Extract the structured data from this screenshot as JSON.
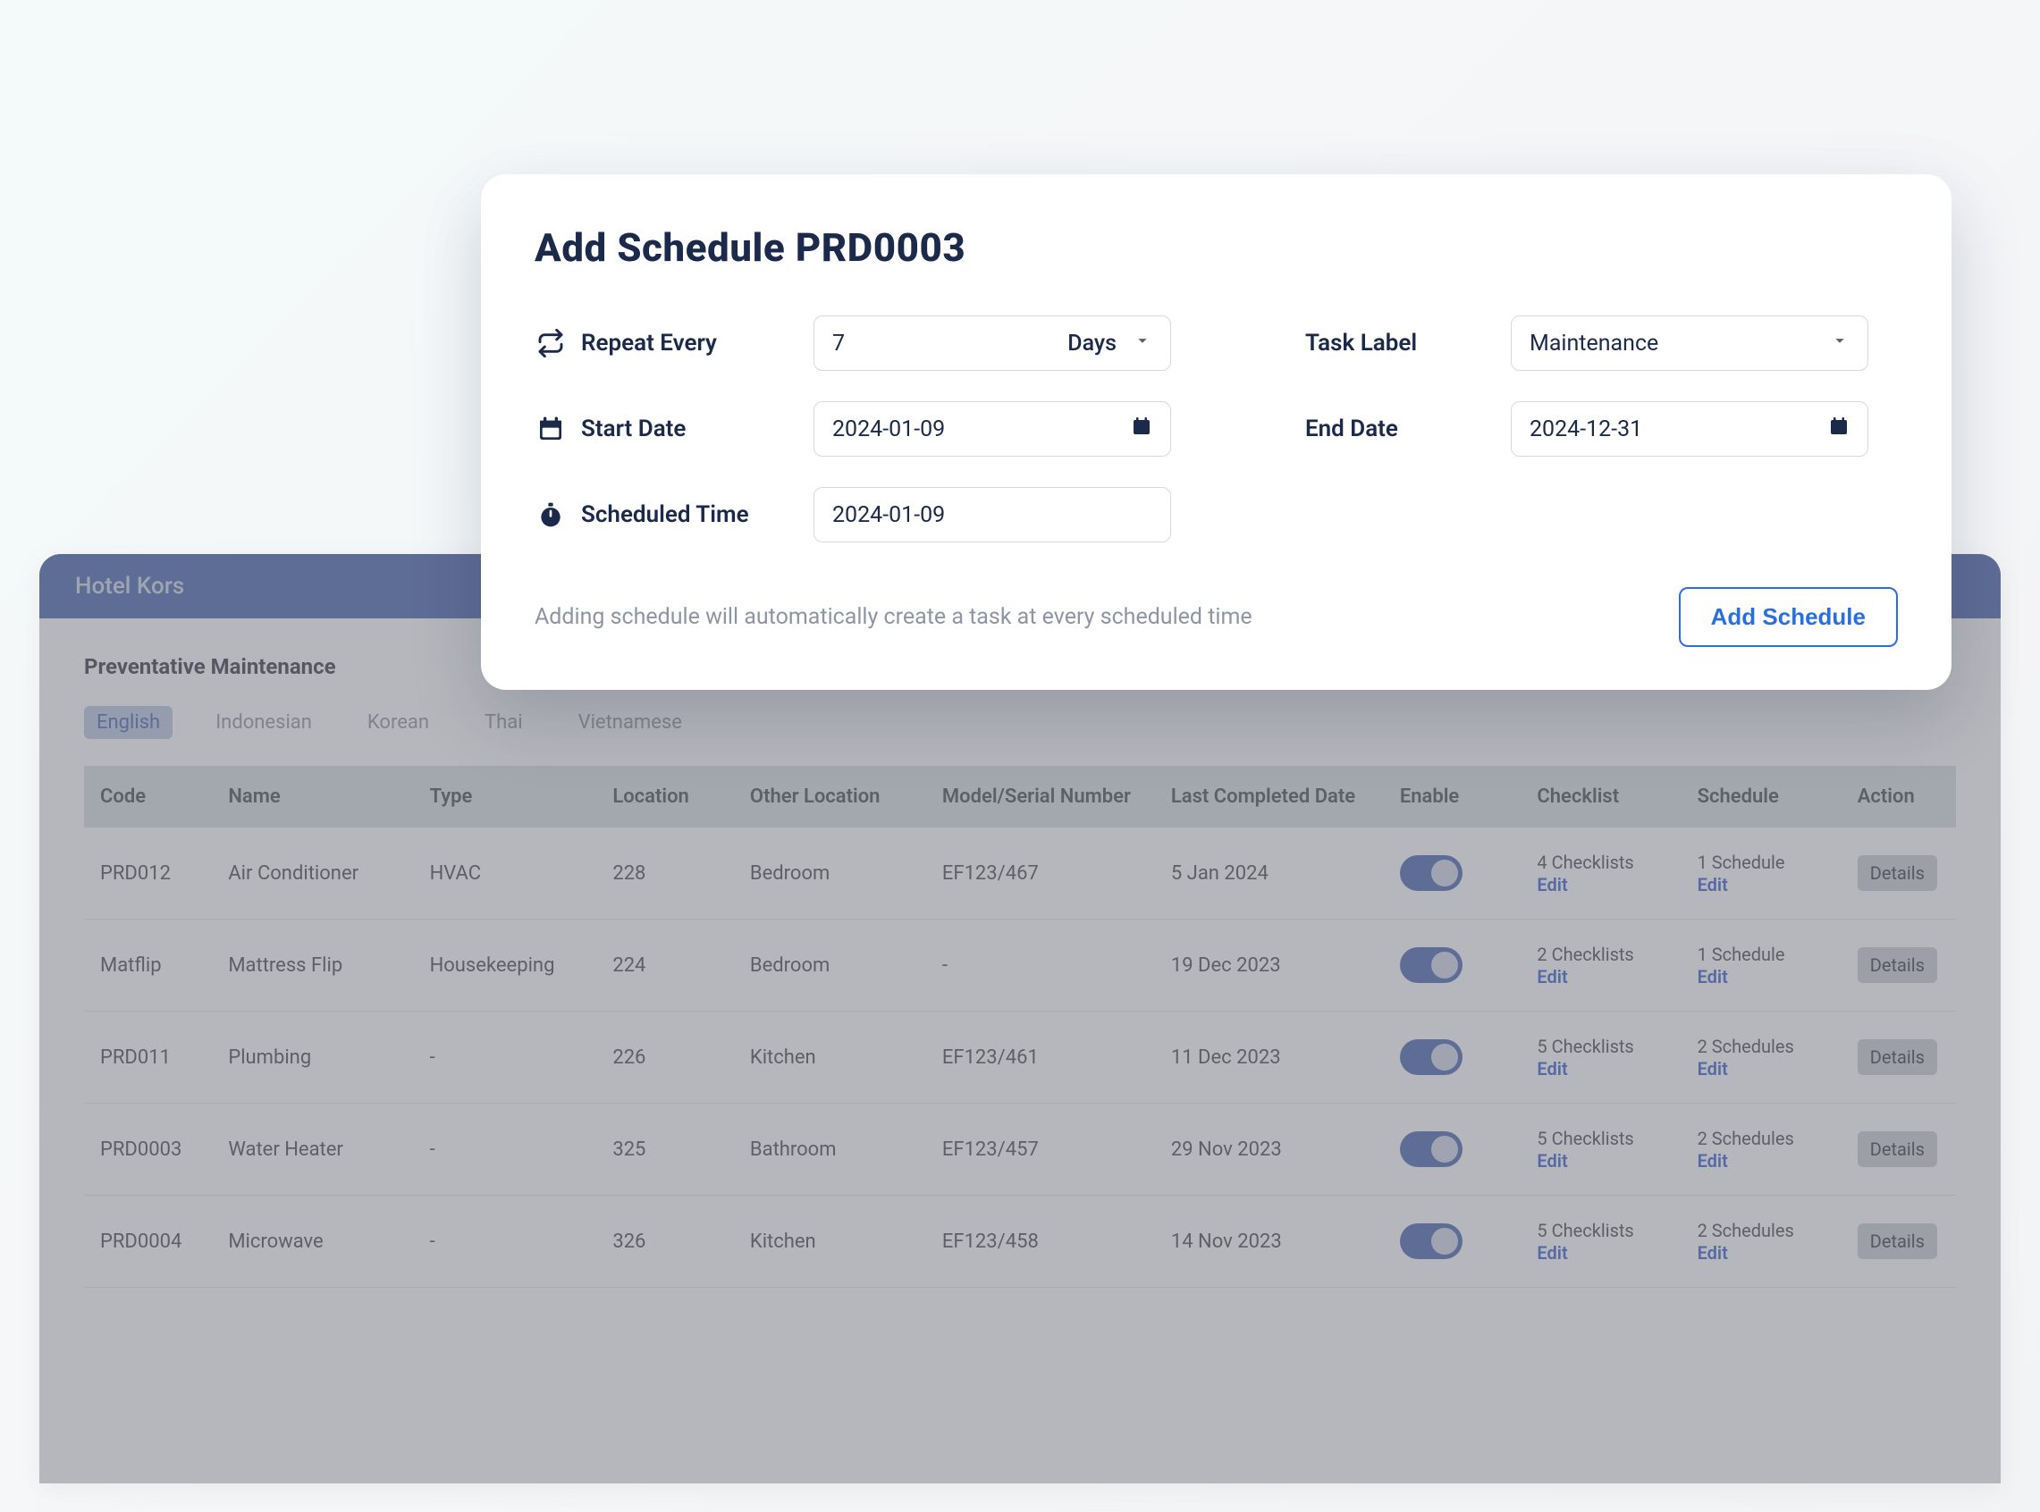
{
  "app": {
    "title": "Hotel Kors",
    "section_title": "Preventative Maintenance",
    "lang_tabs": [
      "English",
      "Indonesian",
      "Korean",
      "Thai",
      "Vietnamese"
    ],
    "columns": [
      "Code",
      "Name",
      "Type",
      "Location",
      "Other Location",
      "Model/Serial Number",
      "Last Completed Date",
      "Enable",
      "Checklist",
      "Schedule",
      "Action"
    ],
    "edit_label": "Edit",
    "details_label": "Details",
    "rows": [
      {
        "code": "PRD012",
        "name": "Air Conditioner",
        "type": "HVAC",
        "location": "228",
        "other": "Bedroom",
        "model": "EF123/467",
        "last": "5 Jan 2024",
        "checklist": "4 Checklists",
        "schedule": "1 Schedule"
      },
      {
        "code": "Matflip",
        "name": "Mattress Flip",
        "type": "Housekeeping",
        "location": "224",
        "other": "Bedroom",
        "model": "-",
        "last": "19 Dec 2023",
        "checklist": "2 Checklists",
        "schedule": "1 Schedule"
      },
      {
        "code": "PRD011",
        "name": "Plumbing",
        "type": "-",
        "location": "226",
        "other": "Kitchen",
        "model": "EF123/461",
        "last": "11 Dec 2023",
        "checklist": "5 Checklists",
        "schedule": "2 Schedules"
      },
      {
        "code": "PRD0003",
        "name": "Water Heater",
        "type": "-",
        "location": "325",
        "other": "Bathroom",
        "model": "EF123/457",
        "last": "29 Nov 2023",
        "checklist": "5 Checklists",
        "schedule": "2 Schedules"
      },
      {
        "code": "PRD0004",
        "name": "Microwave",
        "type": "-",
        "location": "326",
        "other": "Kitchen",
        "model": "EF123/458",
        "last": "14 Nov 2023",
        "checklist": "5 Checklists",
        "schedule": "2 Schedules"
      }
    ]
  },
  "modal": {
    "title": "Add Schedule PRD0003",
    "repeat_label": "Repeat Every",
    "repeat_value": "7",
    "repeat_unit": "Days",
    "task_label_label": "Task Label",
    "task_label_value": "Maintenance",
    "start_date_label": "Start Date",
    "start_date_value": "2024-01-09",
    "end_date_label": "End Date",
    "end_date_value": "2024-12-31",
    "scheduled_time_label": "Scheduled Time",
    "scheduled_time_value": "2024-01-09",
    "footer_note": "Adding schedule will automatically create a task at every scheduled time",
    "add_button": "Add Schedule"
  }
}
